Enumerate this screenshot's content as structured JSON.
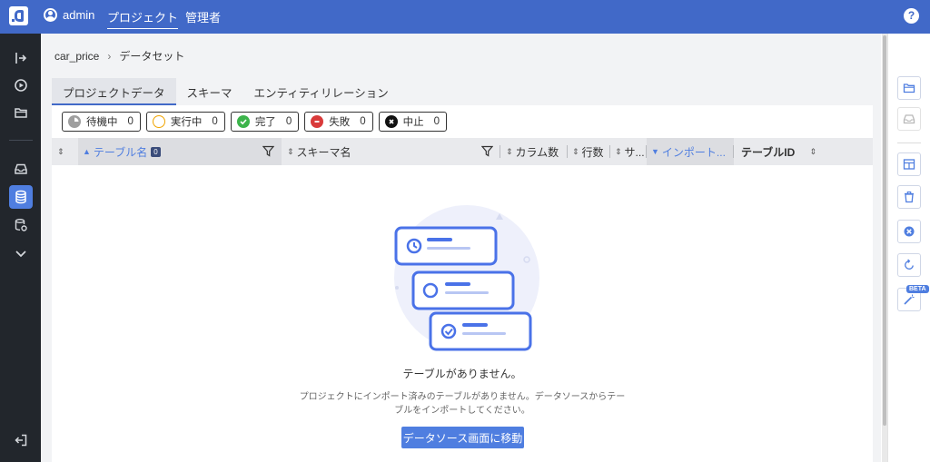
{
  "header": {
    "user": "admin",
    "nav": [
      "プロジェクト",
      "管理者"
    ],
    "help": "?"
  },
  "breadcrumb": [
    "car_price",
    "データセット"
  ],
  "tabs": [
    "プロジェクトデータ",
    "スキーマ",
    "エンティティリレーション"
  ],
  "statuses": [
    {
      "label": "待機中",
      "count": "0",
      "color": "#9e9e9e"
    },
    {
      "label": "実行中",
      "count": "0",
      "color": "#f0a400"
    },
    {
      "label": "完了",
      "count": "0",
      "color": "#3cb44b"
    },
    {
      "label": "失敗",
      "count": "0",
      "color": "#d93a3a"
    },
    {
      "label": "中止",
      "count": "0",
      "color": "#111111"
    }
  ],
  "table": {
    "columns": [
      "テーブル名",
      "スキーマ名",
      "カラム数",
      "行数",
      "サ...",
      "インポート...",
      "テーブルID"
    ],
    "name_badge": "0"
  },
  "empty": {
    "title": "テーブルがありません。",
    "desc_line1": "プロジェクトにインポート済みのテーブルがありません。データソースからテー",
    "desc_line2": "ブルをインポートしてください。",
    "cta": "データソース画面に移動"
  },
  "rightbar": {
    "beta": "BETA"
  },
  "colors": {
    "primary": "#4169c8",
    "accent": "#4f7ee0",
    "sidebar": "#22262c"
  }
}
